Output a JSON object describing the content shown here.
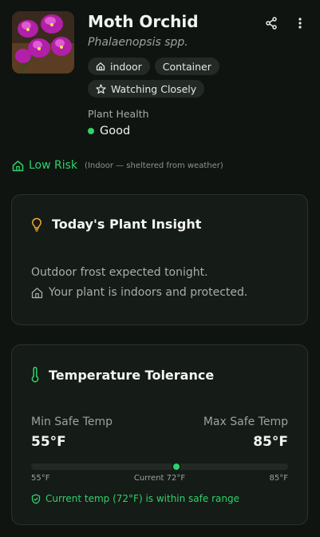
{
  "plant": {
    "name": "Moth Orchid",
    "scientific_name": "Phalaenopsis spp.",
    "tags": [
      "indoor",
      "Container",
      "Watching Closely"
    ],
    "health_label": "Plant Health",
    "health_value": "Good"
  },
  "header_actions": {
    "share_icon": "share-icon",
    "more_icon": "more-vertical-icon"
  },
  "risk": {
    "label": "Low Risk",
    "note": "(Indoor — sheltered from weather)"
  },
  "insight_card": {
    "title": "Today's Plant Insight",
    "line1": "Outdoor frost expected tonight.",
    "line2": "Your plant is indoors and protected."
  },
  "temperature_card": {
    "title": "Temperature Tolerance",
    "min_label": "Min Safe Temp",
    "min_value": "55°F",
    "max_label": "Max Safe Temp",
    "max_value": "85°F",
    "scale_min": "55°F",
    "scale_current": "Current 72°F",
    "scale_max": "85°F",
    "current_fraction": 0.5667,
    "safe_note": "Current temp (72°F) is within safe range"
  },
  "colors": {
    "accent_green": "#2fd16b",
    "insight_icon": "#f0a83a",
    "thermometer_icon": "#2fd16b",
    "background": "#0f1411",
    "card": "#151b17"
  }
}
